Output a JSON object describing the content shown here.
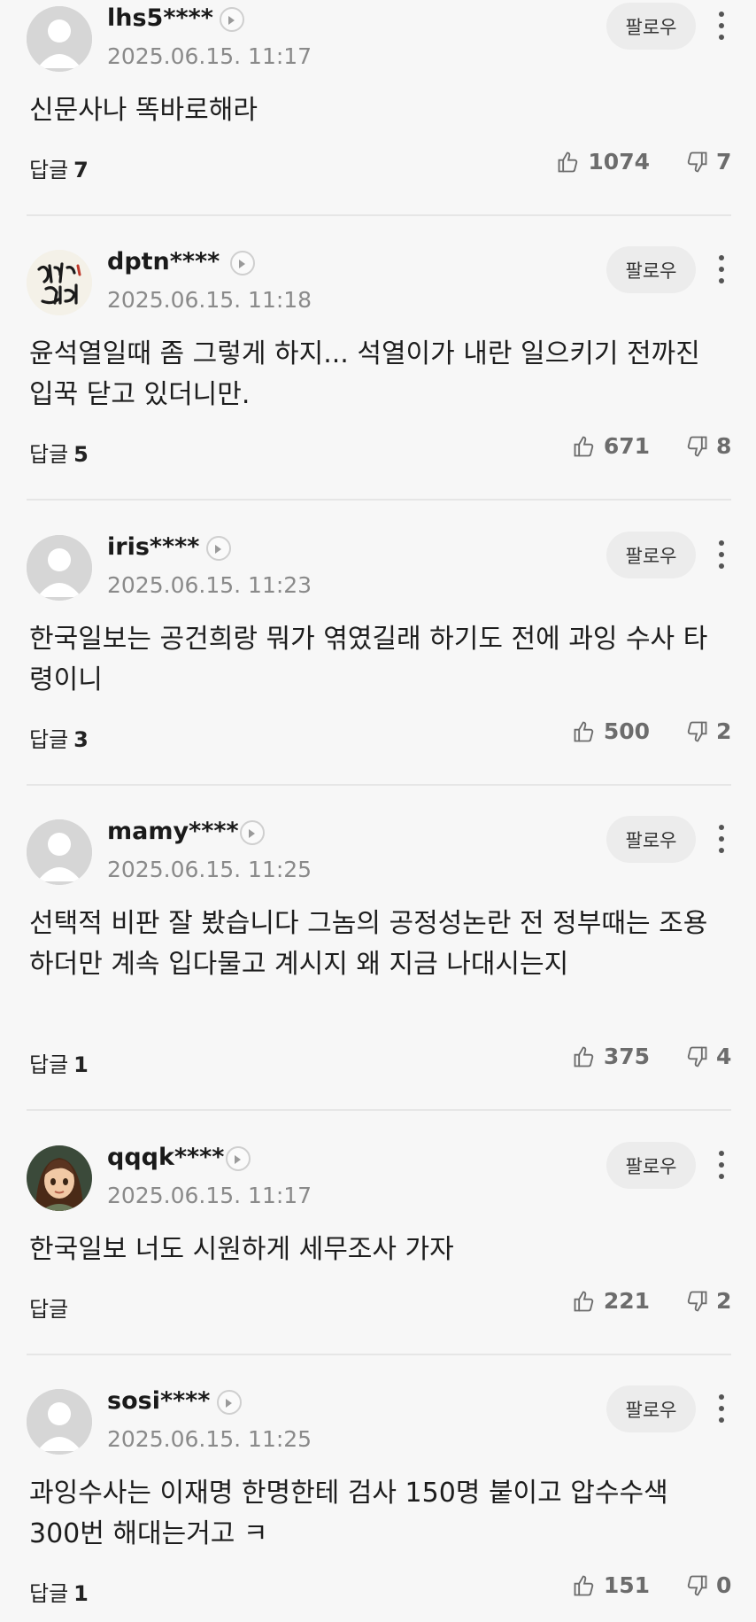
{
  "comments": [
    {
      "username": "lhs5****",
      "date": "2025.06.15. 11:17",
      "follow_label": "팔로우",
      "text": "신문사나 똑바로해라",
      "reply_label": "답글",
      "reply_count": "7",
      "likes": "1074",
      "dislikes": "7",
      "avatar": "default-avatar"
    },
    {
      "username": "dptn****",
      "date": "2025.06.15. 11:18",
      "follow_label": "팔로우",
      "text": "윤석열일때 좀 그렇게 하지... 석열이가 내란 일으키기 전까진 입꾹 닫고 있더니만.",
      "reply_label": "답글",
      "reply_count": "5",
      "likes": "671",
      "dislikes": "8",
      "avatar": "calligraphy-avatar"
    },
    {
      "username": "iris****",
      "date": "2025.06.15. 11:23",
      "follow_label": "팔로우",
      "text": "한국일보는 공건희랑 뭐가 엮였길래 하기도 전에 과잉 수사 타령이니",
      "reply_label": "답글",
      "reply_count": "3",
      "likes": "500",
      "dislikes": "2",
      "avatar": "default-avatar"
    },
    {
      "username": "mamy****",
      "date": "2025.06.15. 11:25",
      "follow_label": "팔로우",
      "text": "선택적 비판 잘 봤습니다 그놈의 공정성논란 전 정부때는 조용하더만 계속 입다물고 계시지 왜 지금 나대시는지",
      "reply_label": "답글",
      "reply_count": "1",
      "likes": "375",
      "dislikes": "4",
      "avatar": "default-avatar"
    },
    {
      "username": "qqqk****",
      "date": "2025.06.15. 11:17",
      "follow_label": "팔로우",
      "text": "한국일보 너도 시원하게 세무조사 가자",
      "reply_label": "답글",
      "reply_count": "",
      "likes": "221",
      "dislikes": "2",
      "avatar": "cartoon-girl-avatar"
    },
    {
      "username": "sosi****",
      "date": "2025.06.15. 11:25",
      "follow_label": "팔로우",
      "text": "과잉수사는 이재명 한명한테 검사 150명 붙이고 압수수색 300번 해대는거고 ㅋ",
      "reply_label": "답글",
      "reply_count": "1",
      "likes": "151",
      "dislikes": "0",
      "avatar": "default-avatar"
    }
  ],
  "colors": {
    "background": "#f7f7f7",
    "follow_button_bg": "#ececec",
    "meta_gray": "#8a8a8a"
  }
}
